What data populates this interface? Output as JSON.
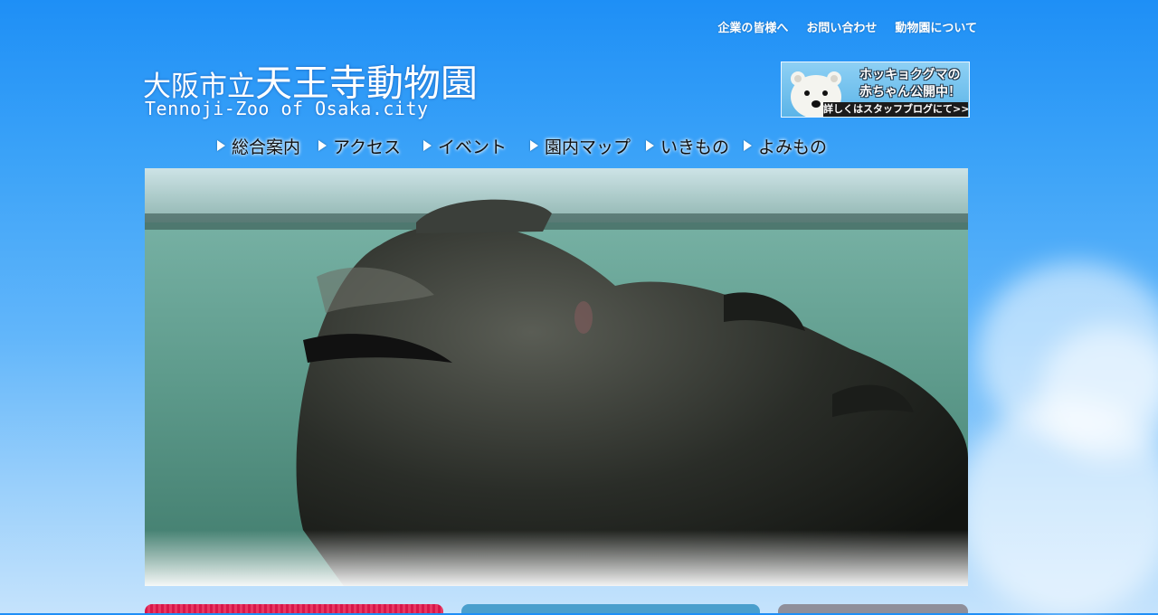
{
  "header": {
    "top_links": [
      {
        "label": "企業の皆様へ"
      },
      {
        "label": "お問い合わせ"
      },
      {
        "label": "動物園について"
      }
    ],
    "logo": {
      "prefix": "大阪市立",
      "name": "天王寺動物園",
      "english": "Tennoji-Zoo of Osaka.city"
    },
    "banner": {
      "line1": "ホッキョクグマの",
      "line2": "赤ちゃん公開中！",
      "line3": "詳しくはスタッフブログにて>>"
    }
  },
  "nav": [
    {
      "label": "総合案内"
    },
    {
      "label": "アクセス"
    },
    {
      "label": "イベント"
    },
    {
      "label": "園内マップ"
    },
    {
      "label": "いきもの"
    },
    {
      "label": "よみもの"
    }
  ],
  "colors": {
    "sky_top": "#1e8ff6",
    "sky_bottom": "#c5e3fc",
    "category_red": "#d8174a",
    "category_blue": "#4a9fcd",
    "category_gray": "#8f8f9a"
  }
}
